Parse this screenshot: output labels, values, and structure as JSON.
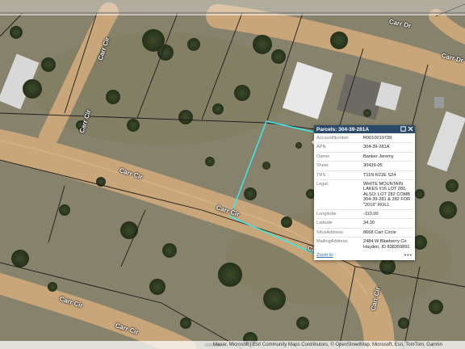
{
  "map": {
    "basemap": "imagery",
    "highlight_color": "#3ee6e6",
    "parcel_line_color": "#1a1a1a",
    "road_color": "#c9a57a"
  },
  "road_labels": {
    "carr_cir_a": "Carr Cir",
    "carr_cir_b": "Carr Cir",
    "carr_cir_c": "Carr Cir",
    "carr_cir_d": "Carr Cir",
    "carr_cir_e": "Carr Cir",
    "carr_cir_f": "Carr Cir",
    "carr_dr_a": "Carr Dr",
    "carr_dr_b": "Carr Dr",
    "carr_cir_g": "Carr Cir",
    "carr_cir_h": "Ca"
  },
  "popup": {
    "title": "Parcels: 304-39-281A",
    "maximize_icon": "maximize-icon",
    "close_icon": "close-icon",
    "fields": [
      {
        "key": "AccountNumber",
        "value": "R0010019739"
      },
      {
        "key": "APN",
        "value": "304-39-281A"
      },
      {
        "key": "Owner",
        "value": "Banker Jeremy"
      },
      {
        "key": "Sheet",
        "value": "30439-05"
      },
      {
        "key": "TRS",
        "value": "T11N R22E S24"
      },
      {
        "key": "Legal",
        "value": "WHITE MOUNTAIN LAKES #16 LOT 281, ALSO: LOT 282 COMB 304-39-281 & 282 FOR \"2016\" ROLL"
      },
      {
        "key": "Longitude",
        "value": "-110.00"
      },
      {
        "key": "Latitude",
        "value": "34.30"
      },
      {
        "key": "SitusAddress",
        "value": "8668 Carr Circle"
      },
      {
        "key": "MailingAddress",
        "value": "2484 W Blueberry Cir Hayden, ID 838359891"
      }
    ],
    "zoom_to": "Zoom to",
    "more": "•••"
  },
  "attribution": "Maxar, Microsoft | Esri Community Maps Contributors, © OpenStreetMap, Microsoft, Esri, TomTom, Garmin"
}
